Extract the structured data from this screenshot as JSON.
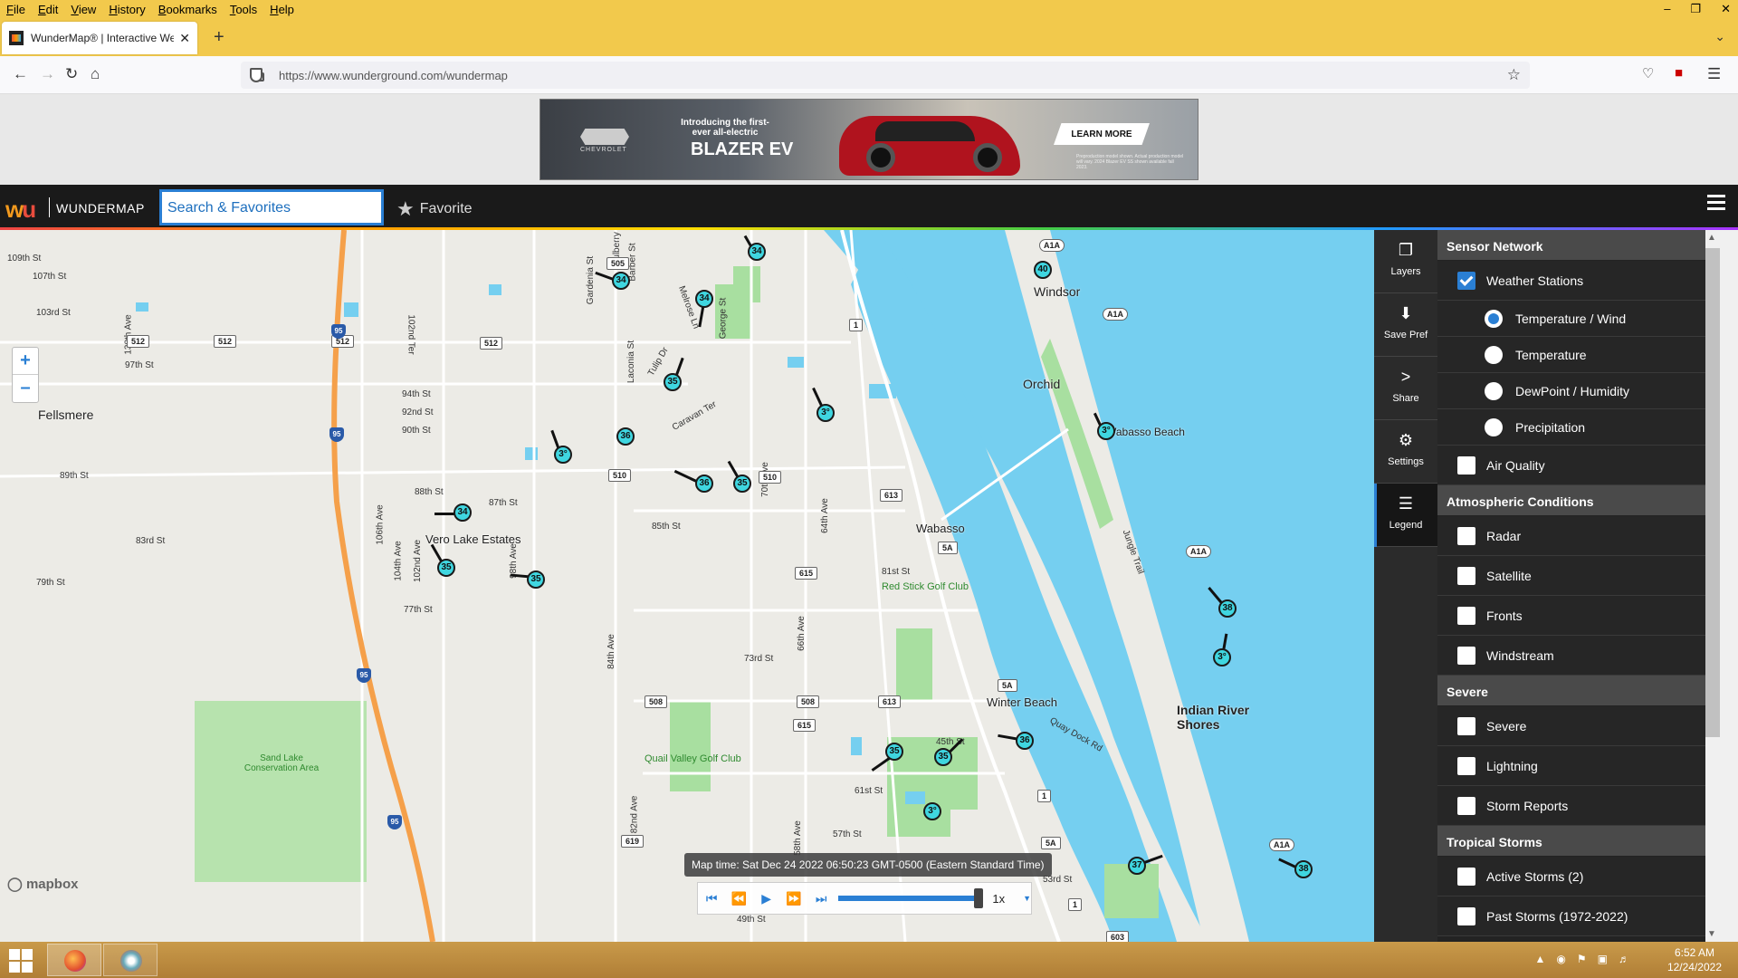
{
  "browser": {
    "menu": [
      "File",
      "Edit",
      "View",
      "History",
      "Bookmarks",
      "Tools",
      "Help"
    ],
    "tab_title": "WunderMap® | Interactive Wea",
    "url": "https://www.wunderground.com/wundermap"
  },
  "ad": {
    "intro": "Introducing the first-ever all-electric",
    "model": "BLAZER EV",
    "brand": "CHEVROLET",
    "cta": "LEARN MORE",
    "fine_print": "Preproduction model shown. Actual production model will vary. 2024 Blazer EV SS shown available fall 2023."
  },
  "header": {
    "logo": "wu",
    "title": "WUNDERMAP",
    "search_placeholder": "Search & Favorites",
    "favorite_label": "Favorite"
  },
  "map": {
    "towns": [
      "Fellsmere",
      "Vero Lake Estates",
      "Wabasso",
      "Windsor",
      "Orchid",
      "Wabasso Beach",
      "Winter Beach",
      "Indian River Shores",
      "Sand Lake Conservation Area"
    ],
    "parks": [
      "Red Stick Golf Club",
      "Quail Valley Golf Club"
    ],
    "streets": [
      "109th St",
      "107th St",
      "103rd St",
      "97th St",
      "94th St",
      "92nd St",
      "90th St",
      "89th St",
      "88th St",
      "87th St",
      "85th St",
      "83rd St",
      "81st St",
      "79th St",
      "77th St",
      "73rd St",
      "61st St",
      "57th St",
      "53rd St",
      "49th St",
      "130th Ave",
      "106th Ave",
      "104th Ave",
      "102nd Ave",
      "98th Ave",
      "82nd Ave",
      "84th Ave",
      "66th Ave",
      "64th Ave",
      "58th Ave",
      "Laconia St",
      "Gardenia St",
      "Barber St",
      "Mulberry St",
      "George St",
      "Tulip Dr",
      "Melrose Ln",
      "Caravan Ter",
      "Jungle Trail",
      "Quay Dock Rd",
      "102nd Ter",
      "70th Ave",
      "45th St"
    ],
    "shields": [
      "512",
      "512",
      "512",
      "512",
      "505",
      "510",
      "510",
      "613",
      "613",
      "615",
      "615",
      "508",
      "508",
      "615",
      "619",
      "603",
      "5A",
      "5A",
      "5A",
      "A1A",
      "A1A",
      "A1A",
      "A1A",
      "1",
      "1",
      "1"
    ],
    "interstate": "95",
    "map_time": "Map time: Sat Dec 24 2022 06:50:23 GMT-0500 (Eastern Standard Time)",
    "playback_speed": "1x",
    "attribution": "mapbox",
    "stations": [
      "34",
      "34",
      "34",
      "35",
      "3°",
      "36",
      "3°",
      "36",
      "35",
      "34",
      "35",
      "35",
      "40",
      "3°",
      "38",
      "3°",
      "35",
      "35",
      "36",
      "3°",
      "37",
      "38"
    ]
  },
  "tools": [
    {
      "label": "Layers",
      "icon": "layers-icon"
    },
    {
      "label": "Save Pref",
      "icon": "save-icon"
    },
    {
      "label": "Share",
      "icon": "share-icon"
    },
    {
      "label": "Settings",
      "icon": "gear-icon"
    },
    {
      "label": "Legend",
      "icon": "list-icon"
    }
  ],
  "panel": {
    "sensor_network": "Sensor Network",
    "weather_stations": "Weather Stations",
    "radio_options": [
      "Temperature / Wind",
      "Temperature",
      "DewPoint / Humidity",
      "Precipitation"
    ],
    "air_quality": "Air Quality",
    "atmospheric": "Atmospheric Conditions",
    "atmo_items": [
      "Radar",
      "Satellite",
      "Fronts",
      "Windstream"
    ],
    "severe_header": "Severe",
    "severe_items": [
      "Severe",
      "Lightning",
      "Storm Reports"
    ],
    "tropical": "Tropical Storms",
    "tropical_items": [
      "Active Storms (2)",
      "Past Storms (1972-2022)"
    ]
  },
  "taskbar": {
    "time": "6:52 AM",
    "date": "12/24/2022"
  }
}
